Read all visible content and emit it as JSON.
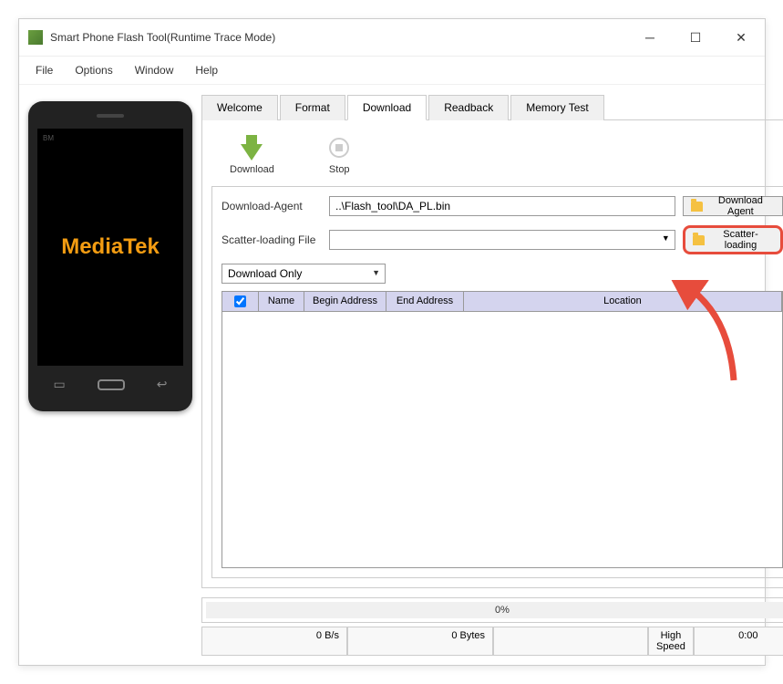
{
  "window": {
    "title": "Smart Phone Flash Tool(Runtime Trace Mode)"
  },
  "menu": {
    "file": "File",
    "options": "Options",
    "window": "Window",
    "help": "Help"
  },
  "phone": {
    "brand_tiny": "BM",
    "brand": "MediaTek"
  },
  "tabs": {
    "welcome": "Welcome",
    "format": "Format",
    "download": "Download",
    "readback": "Readback",
    "memory_test": "Memory Test"
  },
  "toolbar": {
    "download": "Download",
    "stop": "Stop"
  },
  "fields": {
    "download_agent_label": "Download-Agent",
    "download_agent_value": "..\\Flash_tool\\DA_PL.bin",
    "download_agent_btn": "Download Agent",
    "scatter_label": "Scatter-loading File",
    "scatter_value": "",
    "scatter_btn": "Scatter-loading",
    "mode_dropdown": "Download Only"
  },
  "grid": {
    "headers": {
      "name": "Name",
      "begin": "Begin Address",
      "end": "End Address",
      "location": "Location"
    }
  },
  "progress": {
    "percent": "0%"
  },
  "status": {
    "rate": "0 B/s",
    "bytes": "0 Bytes",
    "empty": "",
    "speed": "High Speed",
    "time": "0:00"
  }
}
